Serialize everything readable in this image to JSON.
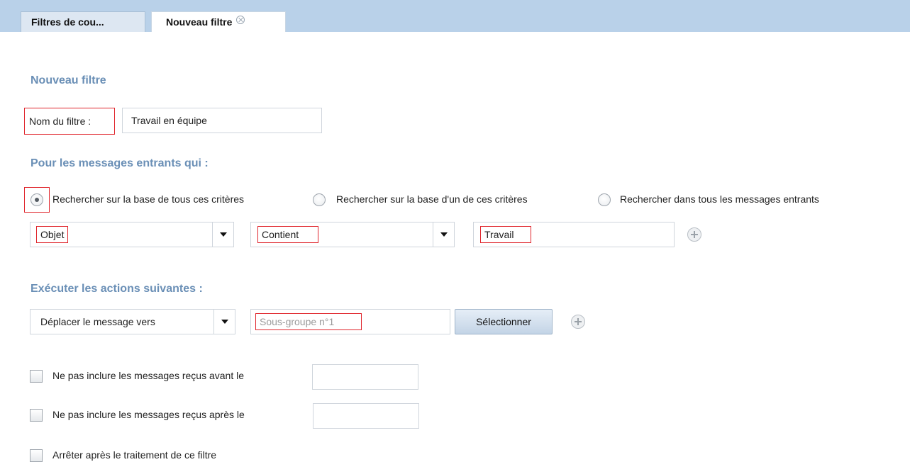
{
  "tabs": [
    {
      "label": "Filtres de cou..."
    },
    {
      "label": "Nouveau filtre"
    }
  ],
  "page": {
    "title": "Nouveau filtre"
  },
  "filter_name": {
    "label": "Nom du filtre :",
    "value": "Travail en équipe"
  },
  "incoming": {
    "title": "Pour les messages entrants qui :",
    "options": [
      {
        "label": "Rechercher sur la base de tous ces critères",
        "checked": true
      },
      {
        "label": "Rechercher sur la base d'un de ces critères",
        "checked": false
      },
      {
        "label": "Rechercher dans tous les messages entrants",
        "checked": false
      }
    ],
    "criterion": {
      "field_value": "Objet",
      "operator_value": "Contient",
      "text_value": "Travail"
    }
  },
  "actions": {
    "title": "Exécuter les actions suivantes :",
    "action_value": "Déplacer le message vers",
    "folder_placeholder": "Sous-groupe n°1",
    "select_button": "Sélectionner"
  },
  "options": {
    "before_label": "Ne pas inclure les messages reçus avant le",
    "after_label": "Ne pas inclure les messages reçus après le",
    "stop_label": "Arrêter après le traitement de ce filtre"
  },
  "colors": {
    "tabbar": "#b9d1e9",
    "section_title": "#6a8fb6",
    "highlight": "#e0242b"
  }
}
